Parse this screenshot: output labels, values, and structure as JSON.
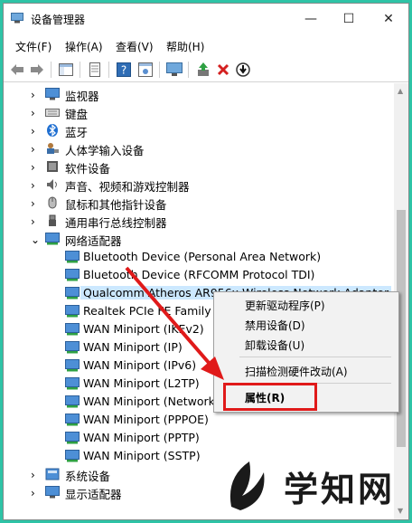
{
  "window": {
    "title": "设备管理器"
  },
  "controls": {
    "minimize": "—",
    "maximize": "☐",
    "close": "✕"
  },
  "menu": [
    "文件(F)",
    "操作(A)",
    "查看(V)",
    "帮助(H)"
  ],
  "tree": [
    {
      "label": "监视器",
      "level": 1,
      "chevron": "›",
      "icon": "monitor-icon"
    },
    {
      "label": "键盘",
      "level": 1,
      "chevron": "›",
      "icon": "keyboard-icon"
    },
    {
      "label": "蓝牙",
      "level": 1,
      "chevron": "›",
      "icon": "bluetooth-icon"
    },
    {
      "label": "人体学输入设备",
      "level": 1,
      "chevron": "›",
      "icon": "hid-icon"
    },
    {
      "label": "软件设备",
      "level": 1,
      "chevron": "›",
      "icon": "software-device-icon"
    },
    {
      "label": "声音、视频和游戏控制器",
      "level": 1,
      "chevron": "›",
      "icon": "speaker-icon"
    },
    {
      "label": "鼠标和其他指针设备",
      "level": 1,
      "chevron": "›",
      "icon": "mouse-icon"
    },
    {
      "label": "通用串行总线控制器",
      "level": 1,
      "chevron": "›",
      "icon": "usb-icon"
    },
    {
      "label": "网络适配器",
      "level": 1,
      "chevron": "⌄",
      "icon": "network-adapter-icon"
    },
    {
      "label": "Bluetooth Device (Personal Area Network)",
      "level": 2,
      "icon": "network-adapter-icon"
    },
    {
      "label": "Bluetooth Device (RFCOMM Protocol TDI)",
      "level": 2,
      "icon": "network-adapter-icon"
    },
    {
      "label": "Qualcomm Atheros AR956x Wireless Network Adapter",
      "level": 2,
      "icon": "network-adapter-icon",
      "selected": true
    },
    {
      "label": "Realtek PCIe FE Family Co",
      "level": 2,
      "icon": "network-adapter-icon"
    },
    {
      "label": "WAN Miniport (IKEv2)",
      "level": 2,
      "icon": "network-adapter-icon"
    },
    {
      "label": "WAN Miniport (IP)",
      "level": 2,
      "icon": "network-adapter-icon"
    },
    {
      "label": "WAN Miniport (IPv6)",
      "level": 2,
      "icon": "network-adapter-icon"
    },
    {
      "label": "WAN Miniport (L2TP)",
      "level": 2,
      "icon": "network-adapter-icon"
    },
    {
      "label": "WAN Miniport (Network",
      "level": 2,
      "icon": "network-adapter-icon"
    },
    {
      "label": "WAN Miniport (PPPOE)",
      "level": 2,
      "icon": "network-adapter-icon"
    },
    {
      "label": "WAN Miniport (PPTP)",
      "level": 2,
      "icon": "network-adapter-icon"
    },
    {
      "label": "WAN Miniport (SSTP)",
      "level": 2,
      "icon": "network-adapter-icon"
    },
    {
      "label": "系统设备",
      "level": 1,
      "chevron": "›",
      "icon": "system-device-icon"
    },
    {
      "label": "显示适配器",
      "level": 1,
      "chevron": "›",
      "icon": "display-adapter-icon"
    }
  ],
  "context_menu": {
    "items": [
      "更新驱动程序(P)",
      "禁用设备(D)",
      "卸载设备(U)",
      "扫描检测硬件改动(A)",
      "属性(R)"
    ]
  },
  "watermark": {
    "text": "学知网"
  },
  "colors": {
    "accent_red": "#e01a1a",
    "selection": "#cce8ff",
    "background": "#2ec3a6"
  }
}
